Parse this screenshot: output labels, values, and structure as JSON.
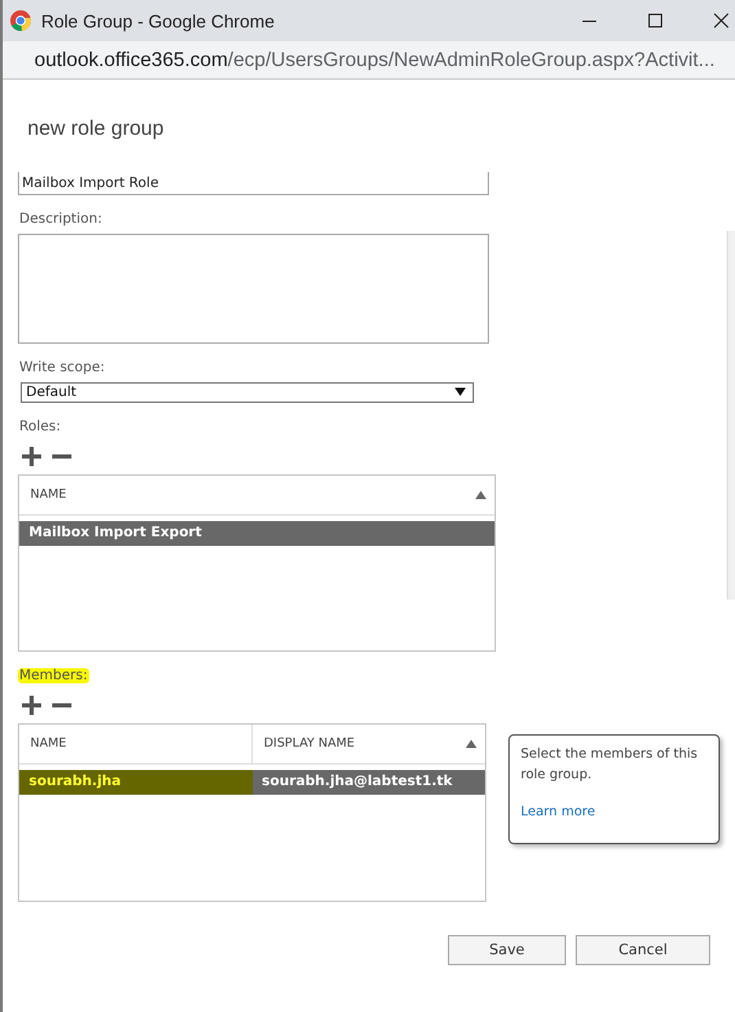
{
  "window": {
    "title": "Role Group - Google Chrome"
  },
  "address_bar": {
    "host": "outlook.office365.com",
    "path": "/ecp/UsersGroups/NewAdminRoleGroup.aspx?Activit..."
  },
  "page_title": "new role group",
  "name_field": {
    "value": "Mailbox Import Role"
  },
  "description": {
    "label": "Description:"
  },
  "write_scope": {
    "label": "Write scope:",
    "value": "Default"
  },
  "roles": {
    "label": "Roles:",
    "highlighted": false,
    "columns": [
      "NAME"
    ],
    "rows": [
      {
        "cells": [
          "Mailbox Import Export"
        ],
        "selected": true,
        "highlighted": false
      }
    ]
  },
  "members": {
    "label": "Members:",
    "highlighted": true,
    "columns": [
      "NAME",
      "DISPLAY NAME"
    ],
    "rows": [
      {
        "cells": [
          "sourabh.jha",
          "sourabh.jha@labtest1.tk"
        ],
        "selected": true,
        "highlighted": true
      }
    ]
  },
  "callout": {
    "text": "Select the members of this role group.",
    "link": "Learn more"
  },
  "buttons": [
    "Save",
    "Cancel"
  ]
}
